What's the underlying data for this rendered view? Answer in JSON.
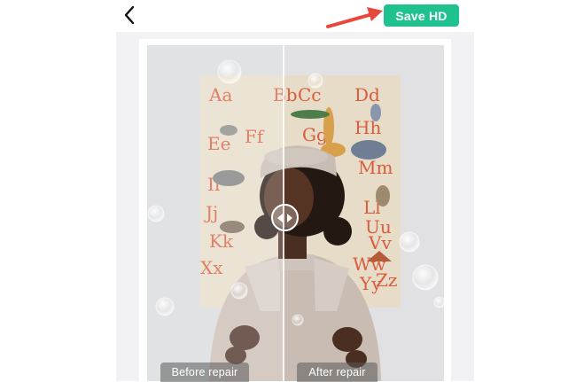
{
  "header": {
    "back_icon": "chevron-left-icon",
    "save_label": "Save HD",
    "save_color": "#1fc28e",
    "annotation_arrow_color": "#e8483b"
  },
  "comparison": {
    "before_label": "Before repair",
    "after_label": "After repair",
    "slider_icon": "left-right-arrows-icon"
  },
  "poster": {
    "letters": [
      "Aa",
      "Bb",
      "Cc",
      "Dd",
      "Ee",
      "Ff",
      "Gg",
      "Hh",
      "Ii",
      "Jj",
      "Kk",
      "Ll",
      "Mm",
      "Uu",
      "Vv",
      "Ww",
      "Xx",
      "Yy",
      "Zz"
    ]
  }
}
